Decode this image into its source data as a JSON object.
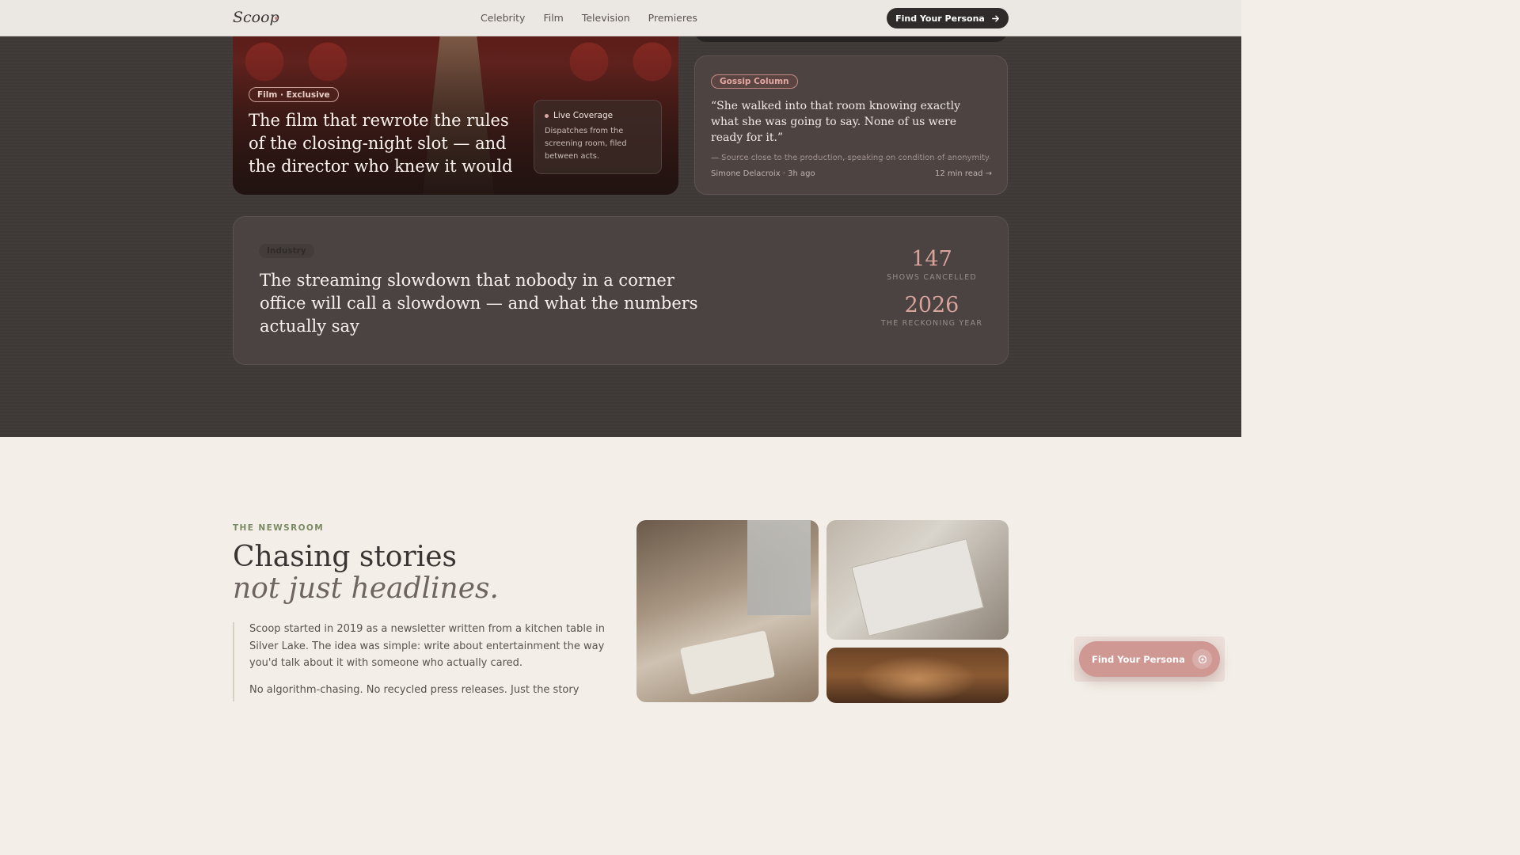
{
  "nav": {
    "logo": "Scoop",
    "links": [
      "Celebrity",
      "Film",
      "Television",
      "Premieres"
    ],
    "cta": "Find Your Persona",
    "cta_icon": "arrow-right-icon"
  },
  "film_card": {
    "tag": "Film · Exclusive",
    "title": "The film that rewrote the rules of the closing-night slot — and the director who knew it would",
    "live": {
      "heading": "Live Coverage",
      "body": "Dispatches from the screening room, filed between acts."
    }
  },
  "gossip_card": {
    "tag": "Gossip Column",
    "quote": "“She walked into that room knowing exactly what she was going to say. None of us were ready for it.”",
    "source": "— Source close to the production, speaking on condition of anonymity",
    "byline": "Simone Delacroix · 3h ago",
    "read": "12 min read →"
  },
  "industry_card": {
    "tag": "Industry",
    "title": "The streaming slowdown that nobody in a corner office will call a slowdown — and what the numbers actually say",
    "stats": [
      {
        "value": "147",
        "label": "SHOWS CANCELLED"
      },
      {
        "value": "2026",
        "label": "THE RECKONING YEAR"
      }
    ]
  },
  "newsroom": {
    "eyebrow": "THE NEWSROOM",
    "heading": "Chasing stories",
    "heading_italic": "not just headlines.",
    "p1": "Scoop started in 2019 as a newsletter written from a kitchen table in Silver Lake. The idea was simple: write about entertainment the way you'd talk about it with someone who actually cared.",
    "p2": "No algorithm-chasing. No recycled press releases. Just the story"
  },
  "floating_cta": {
    "label": "Find Your Persona",
    "icon": "target-icon"
  },
  "colors": {
    "accent": "#cf9892",
    "dark_bg": "#3f3a38",
    "light_bg": "#f3efe8",
    "eyebrow": "#7b8a63"
  }
}
